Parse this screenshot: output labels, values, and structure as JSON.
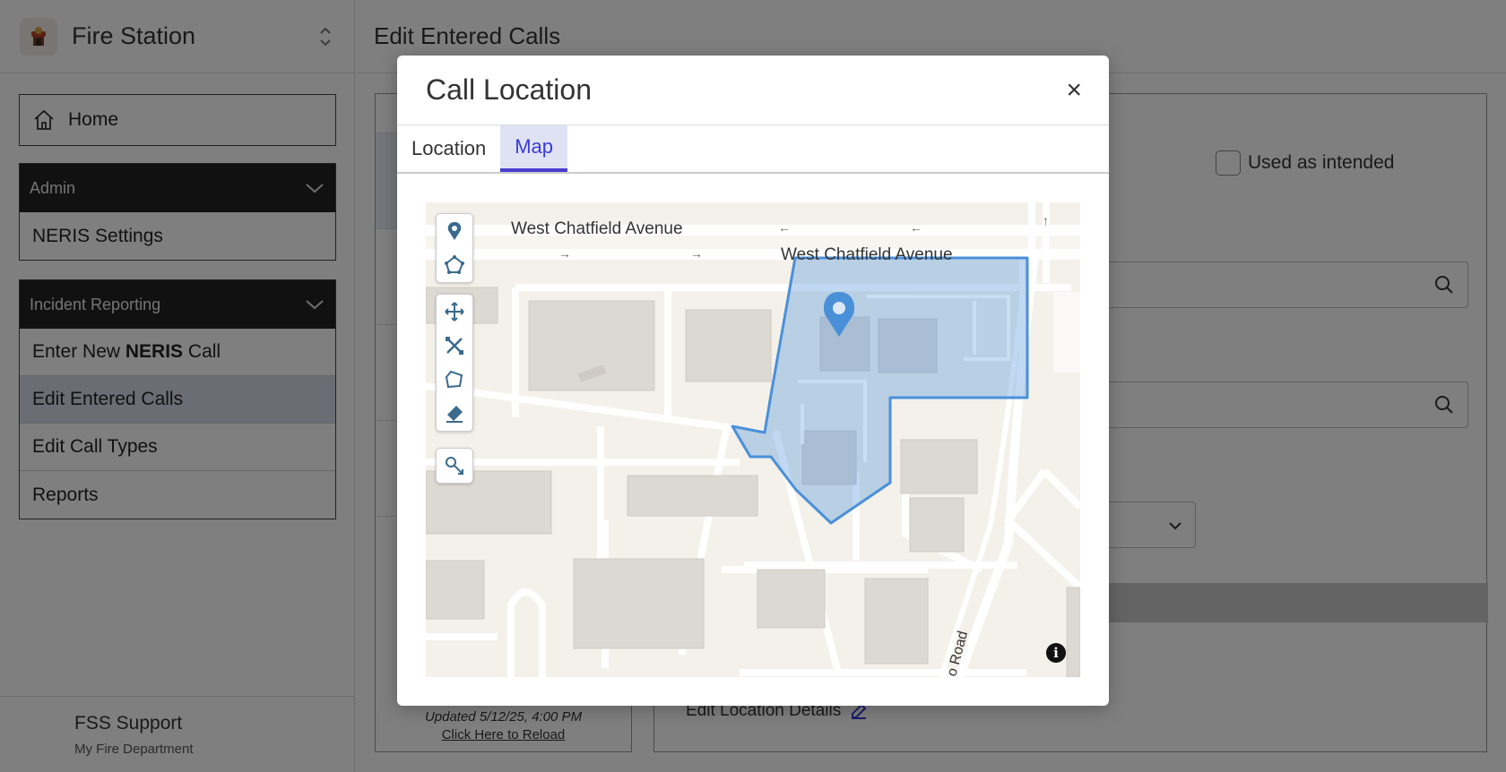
{
  "app": {
    "name": "Fire Station",
    "logo_icon": "fire-station-logo-icon"
  },
  "sidebar": {
    "home_label": "Home",
    "admin": {
      "header": "Admin",
      "items": [
        "NERIS Settings"
      ]
    },
    "incident_reporting": {
      "header": "Incident Reporting",
      "enter_prefix": "Enter New ",
      "enter_bold": "NERIS",
      "enter_suffix": " Call",
      "items": [
        "Edit Entered Calls",
        "Edit Call Types",
        "Reports"
      ],
      "active_item": "Edit Entered Calls"
    },
    "support": {
      "name": "FSS Support",
      "department": "My Fire Department"
    }
  },
  "main": {
    "title": "Edit Entered Calls",
    "list": {
      "updated_text": "Updated 5/12/25, 4:00 PM",
      "reload_link": "Click Here to Reload"
    },
    "detail": {
      "checkbox_label": "Used as intended",
      "edit_location_label": "Edit Location Details"
    }
  },
  "modal": {
    "title": "Call Location",
    "close_glyph": "×",
    "tabs": [
      {
        "label": "Location",
        "active": false
      },
      {
        "label": "Map",
        "active": true
      }
    ],
    "map": {
      "streets": {
        "top": "West Chatfield Avenue",
        "second": "West Chatfield Avenue",
        "road": "o Road"
      },
      "arrows": {
        "left": "←",
        "right": "→",
        "up": "↑"
      },
      "info_glyph": "i",
      "tools": [
        "marker-icon",
        "polygon-draw-icon",
        "move-icon",
        "edit-vertices-icon",
        "rotate-shape-icon",
        "eraser-icon",
        "snapping-icon"
      ],
      "polygon_color": "#4a90d9"
    }
  }
}
